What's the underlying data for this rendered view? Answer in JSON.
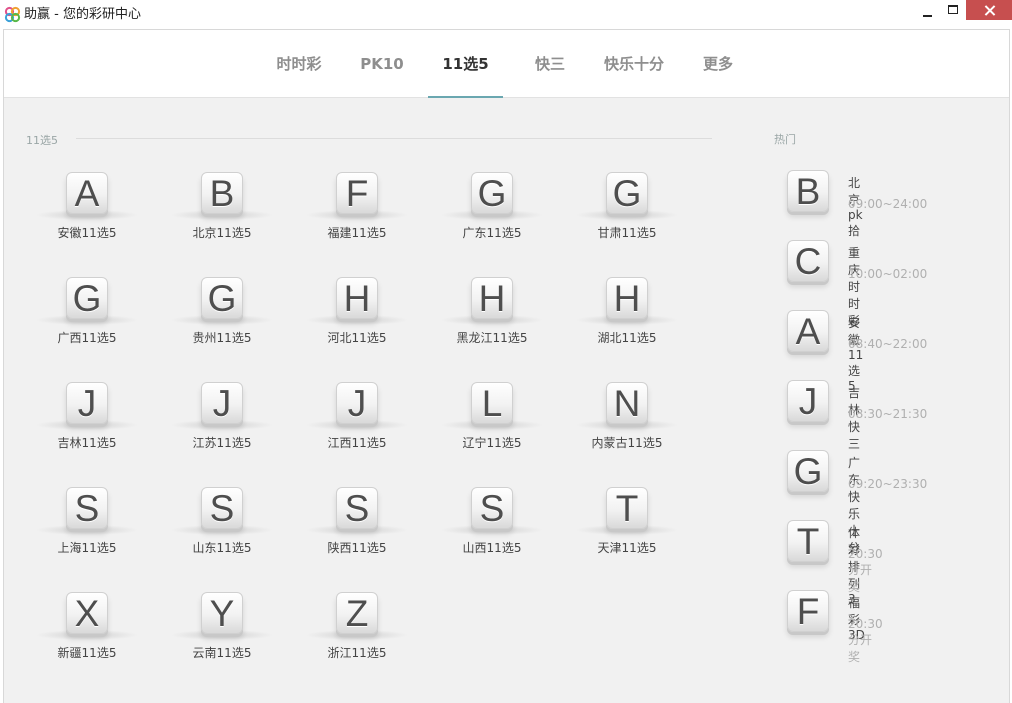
{
  "window": {
    "title": "助赢 - 您的彩研中心"
  },
  "tabs": [
    {
      "label": "时时彩"
    },
    {
      "label": "PK10"
    },
    {
      "label": "11选5",
      "active": true
    },
    {
      "label": "快三"
    },
    {
      "label": "快乐十分"
    },
    {
      "label": "更多"
    }
  ],
  "main": {
    "section_title": "11选5",
    "items": [
      {
        "letter": "A",
        "name": "安徽11选5"
      },
      {
        "letter": "B",
        "name": "北京11选5"
      },
      {
        "letter": "F",
        "name": "福建11选5"
      },
      {
        "letter": "G",
        "name": "广东11选5"
      },
      {
        "letter": "G",
        "name": "甘肃11选5"
      },
      {
        "letter": "G",
        "name": "广西11选5"
      },
      {
        "letter": "G",
        "name": "贵州11选5"
      },
      {
        "letter": "H",
        "name": "河北11选5"
      },
      {
        "letter": "H",
        "name": "黑龙江11选5"
      },
      {
        "letter": "H",
        "name": "湖北11选5"
      },
      {
        "letter": "J",
        "name": "吉林11选5"
      },
      {
        "letter": "J",
        "name": "江苏11选5"
      },
      {
        "letter": "J",
        "name": "江西11选5"
      },
      {
        "letter": "L",
        "name": "辽宁11选5"
      },
      {
        "letter": "N",
        "name": "内蒙古11选5"
      },
      {
        "letter": "S",
        "name": "上海11选5"
      },
      {
        "letter": "S",
        "name": "山东11选5"
      },
      {
        "letter": "S",
        "name": "陕西11选5"
      },
      {
        "letter": "S",
        "name": "山西11选5"
      },
      {
        "letter": "T",
        "name": "天津11选5"
      },
      {
        "letter": "X",
        "name": "新疆11选5"
      },
      {
        "letter": "Y",
        "name": "云南11选5"
      },
      {
        "letter": "Z",
        "name": "浙江11选5"
      }
    ]
  },
  "hot": {
    "title": "热门",
    "items": [
      {
        "letter": "B",
        "name": "北京pk拾",
        "time": "09:00~24:00"
      },
      {
        "letter": "C",
        "name": "重庆时时彩",
        "time": "10:00~02:00"
      },
      {
        "letter": "A",
        "name": "安徽11选5",
        "time": "08:40~22:00"
      },
      {
        "letter": "J",
        "name": "吉林快三",
        "time": "08:30~21:30"
      },
      {
        "letter": "G",
        "name": "广东快乐十分",
        "time": "09:20~23:30"
      },
      {
        "letter": "T",
        "name": "体彩排列3",
        "time": "20:30分开奖"
      },
      {
        "letter": "F",
        "name": "福彩3D",
        "time": "20:30分开奖"
      }
    ]
  }
}
